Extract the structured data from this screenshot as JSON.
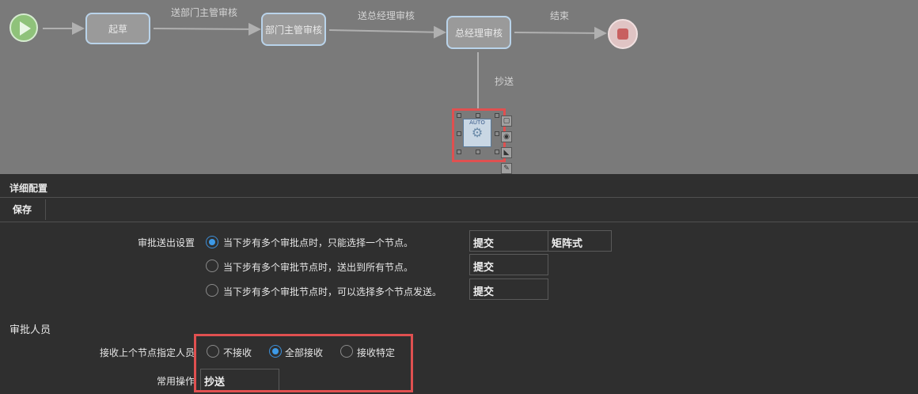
{
  "flow": {
    "nodes": {
      "draft": "起草",
      "dept": "部门主管审核",
      "gm": "总经理审核",
      "auto": "AUTO"
    },
    "edges": {
      "to_dept": "送部门主管审核",
      "to_gm": "送总经理审核",
      "end": "结束",
      "cc": "抄送"
    }
  },
  "panel": {
    "title": "详细配置",
    "save_label": "保存",
    "send_setting_label": "审批送出设置",
    "send_options": [
      "当下步有多个审批点时，只能选择一个节点。",
      "当下步有多个审批节点时，送出到所有节点。",
      "当下步有多个审批节点时，可以选择多个节点发送。"
    ],
    "send_selected_index": 0,
    "submit_values": [
      "提交",
      "提交",
      "提交"
    ],
    "matrix_value": "矩阵式",
    "approvers_section": "审批人员",
    "receive_label": "接收上个节点指定人员",
    "receive_options": [
      "不接收",
      "全部接收",
      "接收特定"
    ],
    "receive_selected_index": 1,
    "common_ops_label": "常用操作",
    "common_ops_value": "抄送"
  },
  "colors": {
    "highlight": "#e05050",
    "radio_active": "#3d9ae8"
  }
}
